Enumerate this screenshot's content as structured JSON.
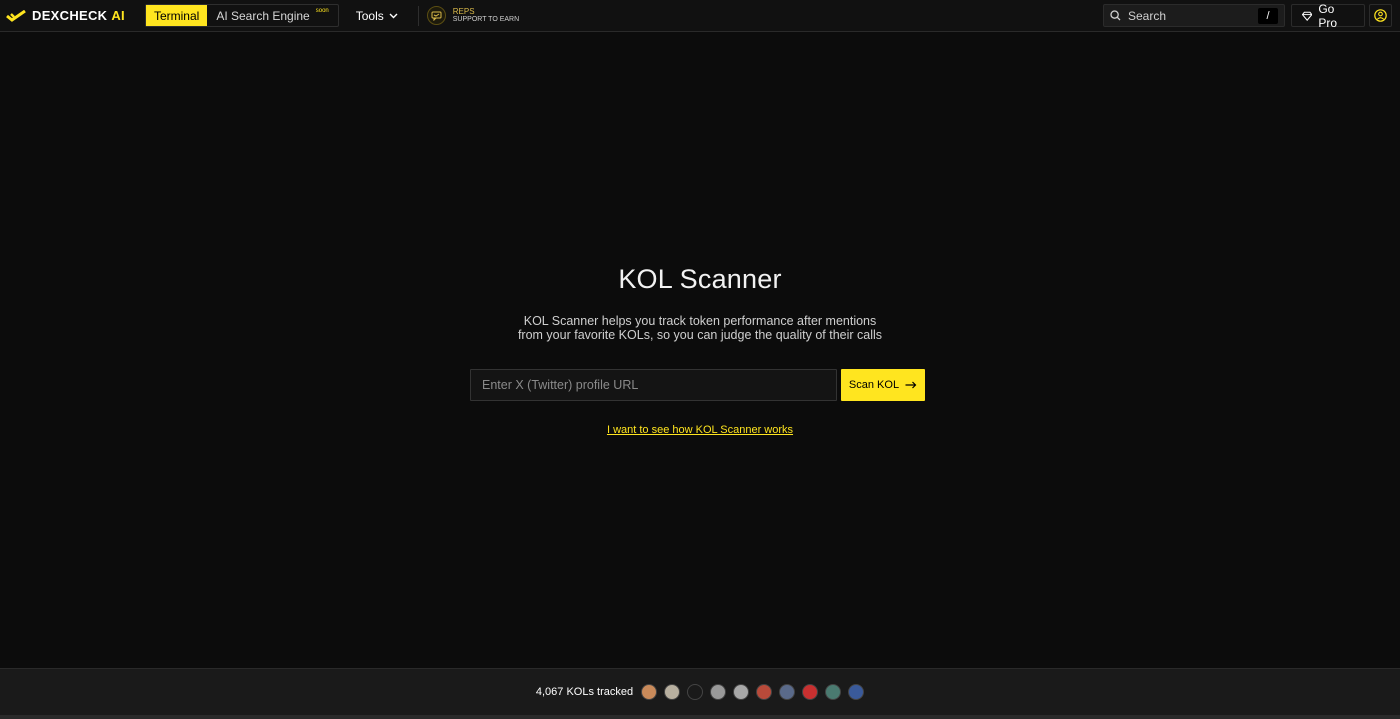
{
  "brand": {
    "name": "DEXCHECK",
    "suffix": "AI",
    "accent": "#ffe51f"
  },
  "nav": {
    "terminal": "Terminal",
    "ai_search": "AI Search Engine",
    "ai_search_badge": "soon",
    "tools": "Tools"
  },
  "reps": {
    "title": "REPS",
    "subtitle": "SUPPORT TO EARN"
  },
  "search": {
    "placeholder": "Search",
    "shortcut": "/"
  },
  "gopro": {
    "label": "Go Pro"
  },
  "main": {
    "title": "KOL Scanner",
    "desc_line1": "KOL Scanner helps you track token performance after mentions",
    "desc_line2": "from your favorite KOLs, so you can judge the quality of their calls",
    "input_placeholder": "Enter X (Twitter) profile URL",
    "scan_button": "Scan KOL",
    "how_link": "I want to see how KOL Scanner works"
  },
  "footer": {
    "tracked": "4,067 KOLs tracked",
    "avatars": [
      {
        "name": "kol-avatar-1",
        "color": "#c98a5a"
      },
      {
        "name": "kol-avatar-2",
        "color": "#b8b0a0"
      },
      {
        "name": "kol-avatar-3",
        "color": "#1a1a1a"
      },
      {
        "name": "kol-avatar-4",
        "color": "#9a9a9a"
      },
      {
        "name": "kol-avatar-5",
        "color": "#a8a8a8"
      },
      {
        "name": "kol-avatar-6",
        "color": "#b84a3a"
      },
      {
        "name": "kol-avatar-7",
        "color": "#5a6a8a"
      },
      {
        "name": "kol-avatar-8",
        "color": "#c83030"
      },
      {
        "name": "kol-avatar-9",
        "color": "#4a7a70"
      },
      {
        "name": "kol-avatar-10",
        "color": "#3a5a9a"
      }
    ]
  }
}
